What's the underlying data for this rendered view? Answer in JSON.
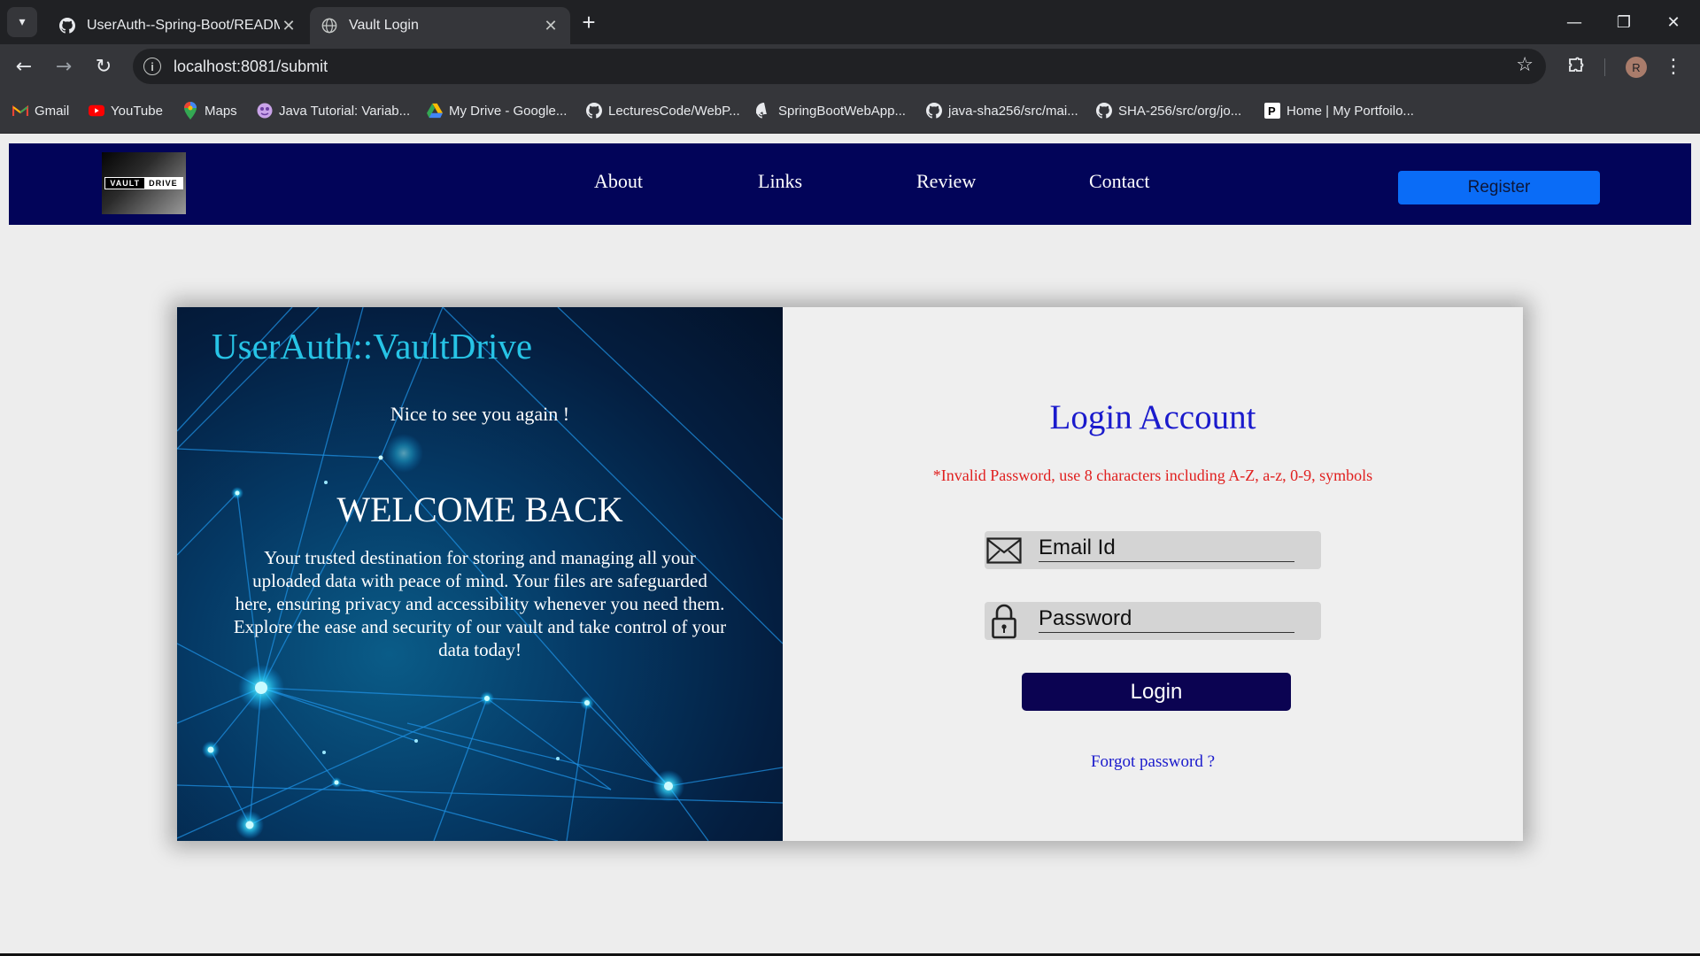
{
  "browser": {
    "tabs": [
      {
        "title": "UserAuth--Spring-Boot/README",
        "icon": "github-icon",
        "active": false
      },
      {
        "title": "Vault Login",
        "icon": "globe-icon",
        "active": true
      }
    ],
    "url": "localhost:8081/submit",
    "profile_initial": "R",
    "bookmarks": [
      {
        "label": "Gmail",
        "icon": "gmail-icon"
      },
      {
        "label": "YouTube",
        "icon": "youtube-icon"
      },
      {
        "label": "Maps",
        "icon": "maps-icon"
      },
      {
        "label": "Java Tutorial: Variab...",
        "icon": "java-tutorial-icon"
      },
      {
        "label": "My Drive - Google...",
        "icon": "google-drive-icon"
      },
      {
        "label": "LecturesCode/WebP...",
        "icon": "github-icon"
      },
      {
        "label": "SpringBootWebApp...",
        "icon": "github-icon"
      },
      {
        "label": "java-sha256/src/mai...",
        "icon": "github-icon"
      },
      {
        "label": "SHA-256/src/org/jo...",
        "icon": "github-icon"
      },
      {
        "label": "Home | My Portfoilo...",
        "icon": "portfolio-icon"
      }
    ]
  },
  "navbar": {
    "logo": {
      "left": "VAULT",
      "right": "DRIVE"
    },
    "links": [
      "About",
      "Links",
      "Review",
      "Contact"
    ],
    "register_label": "Register",
    "colors": {
      "background": "#020459",
      "register": "#0a6cf7"
    }
  },
  "hero": {
    "title": "UserAuth::VaultDrive",
    "greeting": "Nice to see you again !",
    "welcome": "WELCOME BACK",
    "description": "Your trusted destination for storing and managing all your uploaded data with peace of mind. Your files are safeguarded here, ensuring privacy and accessibility whenever you need them. Explore the ease and security of our vault and take control of your data today!"
  },
  "login": {
    "title": "Login Account",
    "error": "*Invalid Password, use 8 characters including A-Z, a-z, 0-9, symbols",
    "email_placeholder": "Email Id",
    "password_placeholder": "Password",
    "button_label": "Login",
    "forgot_label": "Forgot password ?",
    "colors": {
      "title": "#1a1acc",
      "error": "#e0201f",
      "button": "#0b0352"
    }
  }
}
